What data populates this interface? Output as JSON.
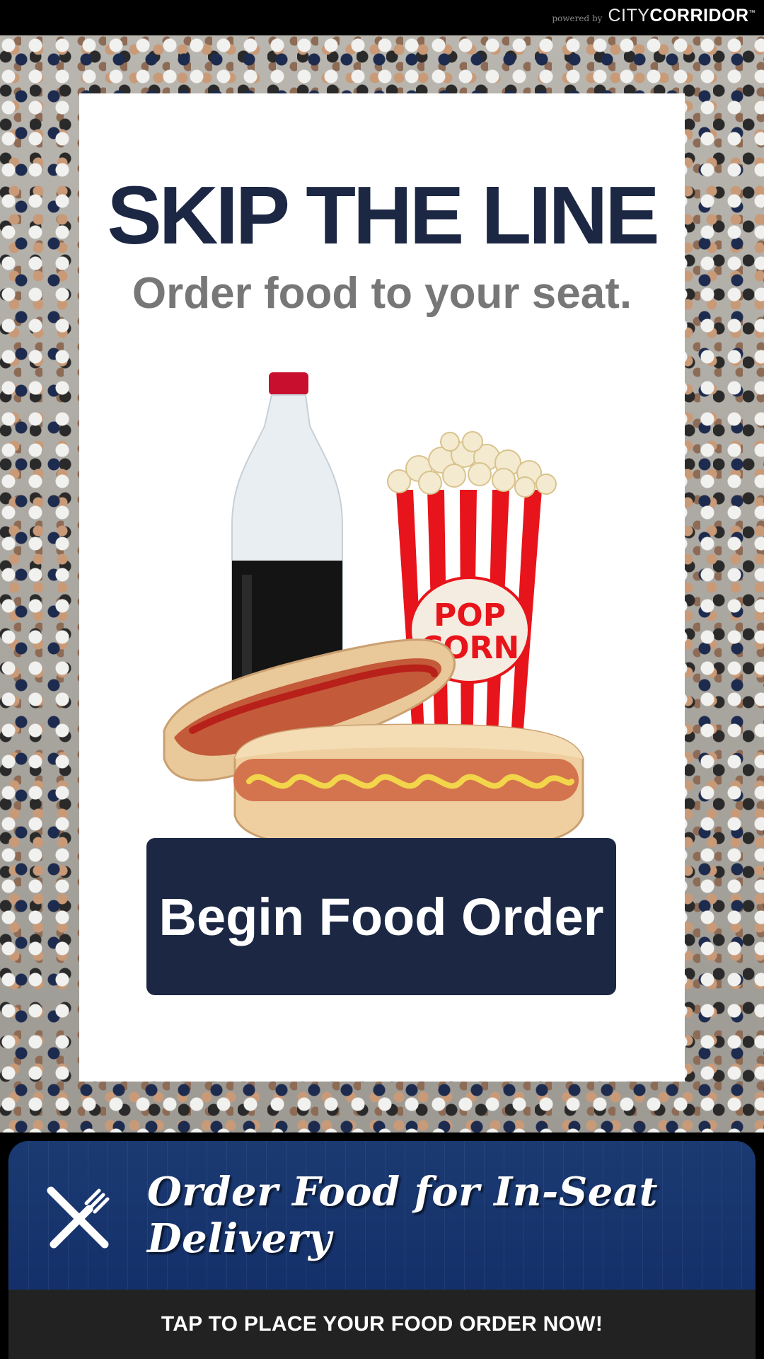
{
  "header": {
    "powered_by": "powered by",
    "logo_part1": "CITY",
    "logo_part2": "CORRIDOR",
    "logo_tm": "™"
  },
  "promo": {
    "headline": "SKIP THE LINE",
    "subheadline": "Order food to your seat.",
    "popcorn_label_line1": "POP",
    "popcorn_label_line2": "CORN",
    "begin_button_label": "Begin Food Order"
  },
  "banner": {
    "icon": "fork-knife-icon",
    "title": "Order Food for In-Seat Delivery",
    "cta": "TAP TO PLACE YOUR FOOD ORDER NOW!"
  },
  "colors": {
    "navy": "#1c2744",
    "banner_blue": "#1b3a72",
    "popcorn_red": "#e8141b",
    "subhead_gray": "#777777"
  }
}
